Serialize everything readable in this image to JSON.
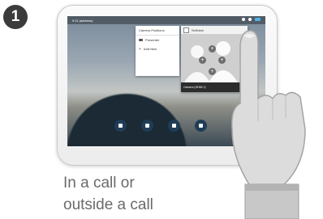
{
  "step": {
    "number": "1"
  },
  "status_bar": {
    "left_text": "9:11 (address)"
  },
  "camera_panel": {
    "title": "Camera Positions",
    "items": [
      {
        "label": "Presenter",
        "icon": "camera-icon"
      },
      {
        "label": "Add New",
        "icon": "plus-icon"
      }
    ]
  },
  "selfview_panel": {
    "title": "Selfview",
    "footer": "Camera (HDMI 1)"
  },
  "dock": {
    "buttons": [
      {
        "label": "",
        "icon": "keypad-icon"
      },
      {
        "label": "",
        "icon": "contacts-icon"
      },
      {
        "label": "",
        "icon": "meetings-icon"
      },
      {
        "label": "",
        "icon": "messages-icon"
      }
    ]
  },
  "caption": {
    "line1": "In a call or",
    "line2": "outside a call"
  },
  "colors": {
    "badge": "#3b3b3b",
    "caption": "#6a6a6a",
    "accent": "#4bb3e8"
  }
}
